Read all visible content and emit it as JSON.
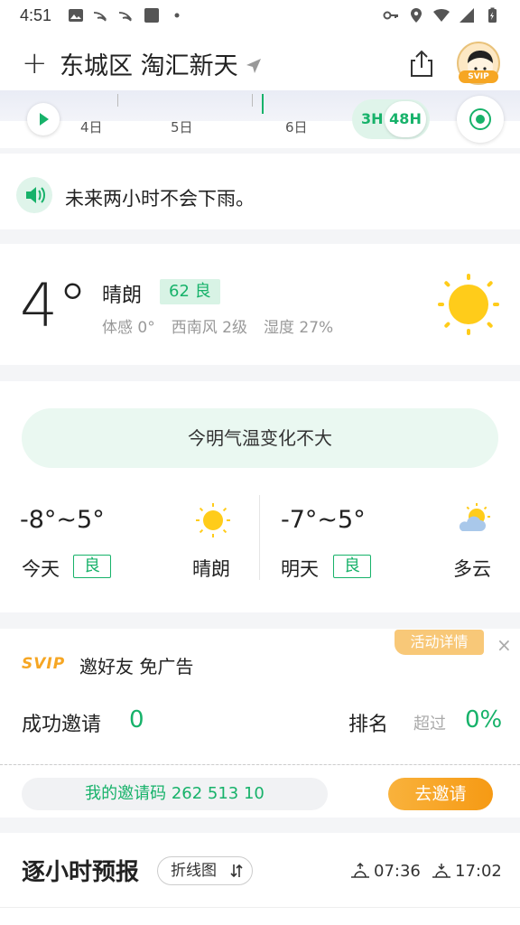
{
  "status_bar": {
    "time": "4:51"
  },
  "header": {
    "add_label": "+",
    "location": "东城区 淘汇新天",
    "svip_badge": "SVIP"
  },
  "timeline": {
    "ticks": [
      "4日",
      "5日",
      "6日"
    ],
    "range_3h": "3H",
    "range_48h": "48H"
  },
  "rain_notice": {
    "text": "未来两小时不会下雨。"
  },
  "current": {
    "temperature": "4°",
    "condition": "晴朗",
    "aqi": "62 良",
    "feels_like": "体感 0°",
    "wind": "西南风 2级",
    "humidity": "湿度 27%"
  },
  "daily": {
    "trend": "今明气温变化不大",
    "today": {
      "range": "-8°~5°",
      "label": "今天",
      "aqi": "良",
      "condition": "晴朗",
      "icon": "sun-icon"
    },
    "tomorrow": {
      "range": "-7°~5°",
      "label": "明天",
      "aqi": "良",
      "condition": "多云",
      "icon": "partly-cloudy-icon"
    }
  },
  "invite": {
    "svip_logo": "SVIP",
    "title": "邀好友 免广告",
    "activity_label": "活动详情",
    "close": "×",
    "success_label": "成功邀请",
    "success_count": "0",
    "rank_label": "排名",
    "beat_label": "超过",
    "beat_percent": "0%",
    "code_text": "我的邀请码  262  513 10",
    "invite_button": "去邀请"
  },
  "hourly": {
    "title": "逐小时预报",
    "chart_toggle": "折线图",
    "sunrise": "07:36",
    "sunset": "17:02"
  },
  "colors": {
    "accent": "#17b26a",
    "orange": "#f6a623",
    "sun": "#ffcc1a"
  }
}
